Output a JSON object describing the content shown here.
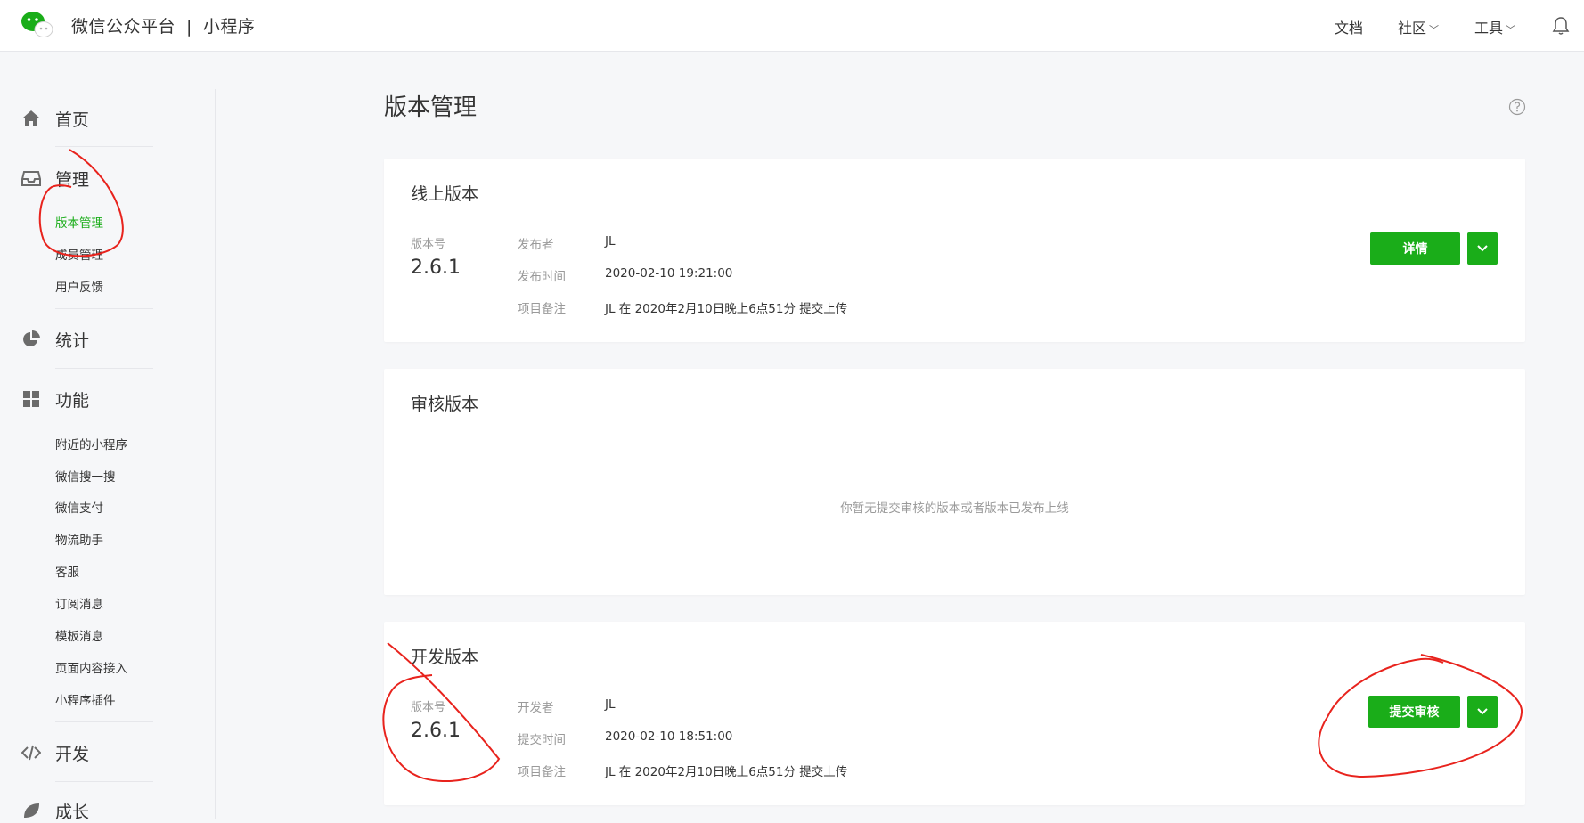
{
  "header": {
    "brand": "微信公众平台",
    "separator": "|",
    "product": "小程序",
    "nav": {
      "docs": "文档",
      "community": "社区",
      "tools": "工具"
    }
  },
  "sidebar": {
    "home": "首页",
    "manage": "管理",
    "manage_items": [
      "版本管理",
      "成员管理",
      "用户反馈"
    ],
    "stats": "统计",
    "features": "功能",
    "feature_items": [
      "附近的小程序",
      "微信搜一搜",
      "微信支付",
      "物流助手",
      "客服",
      "订阅消息",
      "模板消息",
      "页面内容接入",
      "小程序插件"
    ],
    "develop": "开发",
    "growth": "成长"
  },
  "page": {
    "title": "版本管理"
  },
  "online": {
    "title": "线上版本",
    "version_label": "版本号",
    "version": "2.6.1",
    "publisher_label": "发布者",
    "publisher": "JL",
    "time_label": "发布时间",
    "time": "2020-02-10 19:21:00",
    "note_label": "项目备注",
    "note": "JL 在 2020年2月10日晚上6点51分 提交上传",
    "button": "详情"
  },
  "review": {
    "title": "审核版本",
    "empty": "你暂无提交审核的版本或者版本已发布上线"
  },
  "dev": {
    "title": "开发版本",
    "version_label": "版本号",
    "version": "2.6.1",
    "developer_label": "开发者",
    "developer": "JL",
    "time_label": "提交时间",
    "time": "2020-02-10 18:51:00",
    "note_label": "项目备注",
    "note": "JL 在 2020年2月10日晚上6点51分 提交上传",
    "button": "提交审核"
  },
  "colors": {
    "accent": "#1aad19",
    "annotation": "#e8231d"
  }
}
